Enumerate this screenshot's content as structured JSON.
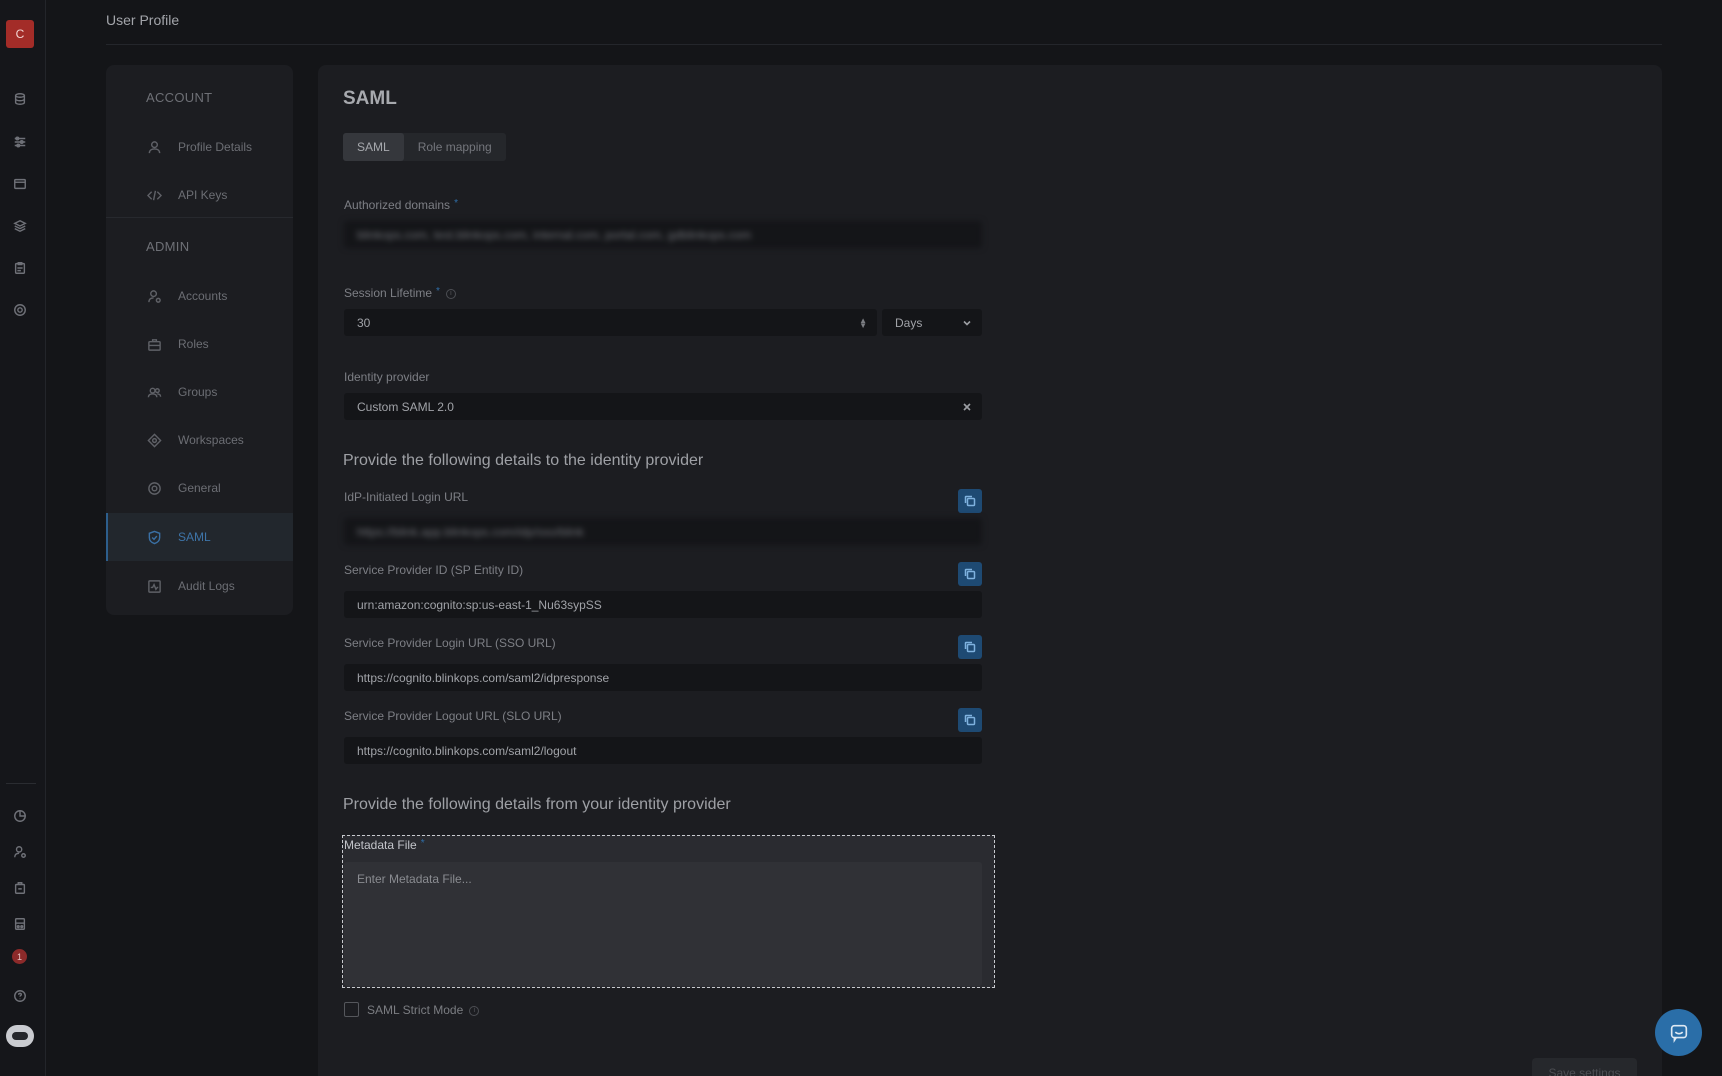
{
  "app": {
    "logo_letter": "C",
    "page_title": "User Profile",
    "notification_count": "1"
  },
  "rail": {
    "top_icons": [
      "database-icon",
      "sliders-icon",
      "window-icon",
      "layers-icon",
      "clipboard-icon",
      "target-icon"
    ],
    "bottom_icons": [
      "pie-chart-icon",
      "user-gear-icon",
      "package-icon",
      "bookmark-box-icon",
      "help-icon"
    ]
  },
  "nav": {
    "account_header": "ACCOUNT",
    "admin_header": "ADMIN",
    "items": [
      {
        "label": "Profile Details",
        "icon": "user-icon"
      },
      {
        "label": "API Keys",
        "icon": "code-icon"
      },
      {
        "label": "Accounts",
        "icon": "user-gear-icon"
      },
      {
        "label": "Roles",
        "icon": "briefcase-icon"
      },
      {
        "label": "Groups",
        "icon": "users-icon"
      },
      {
        "label": "Workspaces",
        "icon": "diamond-icon"
      },
      {
        "label": "General",
        "icon": "settings-icon"
      },
      {
        "label": "SAML",
        "icon": "shield-icon",
        "active": true
      },
      {
        "label": "Audit Logs",
        "icon": "activity-icon"
      }
    ]
  },
  "main": {
    "title": "SAML",
    "tabs": [
      {
        "label": "SAML",
        "active": true
      },
      {
        "label": "Role mapping",
        "active": false
      }
    ],
    "authorized_domains": {
      "label": "Authorized domains",
      "required": "*",
      "value": "blinkops.com, test.blinkops.com, internal.com, portal.com, gdblinkops.com"
    },
    "session_lifetime": {
      "label": "Session Lifetime",
      "required": "*",
      "info": "i",
      "value": "30",
      "unit": "Days"
    },
    "identity_provider": {
      "label": "Identity provider",
      "value": "Custom SAML 2.0"
    },
    "to_idp_heading": "Provide the following details to the identity provider",
    "idp_login_url": {
      "label": "IdP-Initiated Login URL",
      "value": "https://blink.app.blinkops.com/idp/sso/blink"
    },
    "sp_entity_id": {
      "label": "Service Provider ID (SP Entity ID)",
      "value": "urn:amazon:cognito:sp:us-east-1_Nu63sypSS"
    },
    "sp_login_url": {
      "label": "Service Provider Login URL (SSO URL)",
      "value": "https://cognito.blinkops.com/saml2/idpresponse"
    },
    "sp_logout_url": {
      "label": "Service Provider Logout URL (SLO URL)",
      "value": "https://cognito.blinkops.com/saml2/logout"
    },
    "from_idp_heading": "Provide the following details from your identity provider",
    "metadata_file": {
      "label": "Metadata File",
      "required": "*",
      "placeholder": "Enter Metadata File..."
    },
    "strict_mode": {
      "label": "SAML Strict Mode",
      "info": "i",
      "checked": false
    },
    "save_label": "Save settings"
  },
  "colors": {
    "accent": "#2f6ea8",
    "brand": "#a32c28"
  }
}
